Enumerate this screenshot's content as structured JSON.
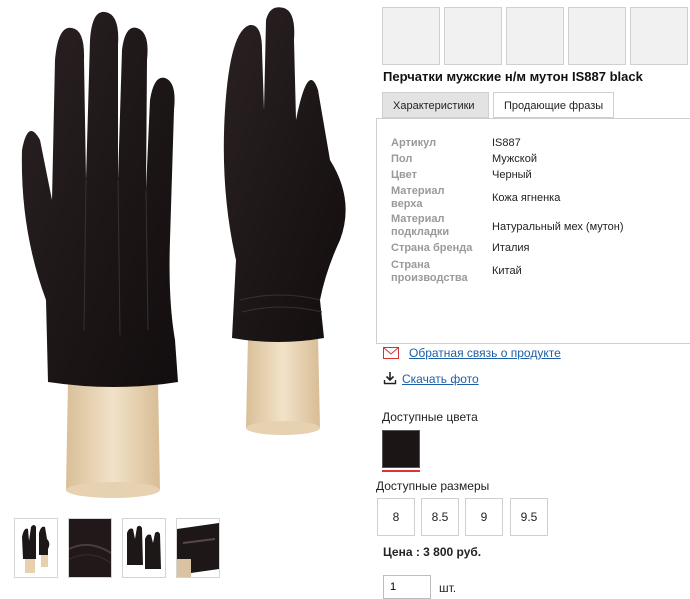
{
  "product": {
    "title": "Перчатки мужские н/м мутон IS887 black"
  },
  "tabs": [
    {
      "label": "Характеристики",
      "active": true
    },
    {
      "label": "Продающие фразы",
      "active": false
    }
  ],
  "specs": [
    {
      "label": "Артикул",
      "value": "IS887"
    },
    {
      "label": "Пол",
      "value": "Мужской"
    },
    {
      "label": "Цвет",
      "value": "Черный"
    },
    {
      "label": "Материал верха",
      "value": "Кожа ягненка"
    },
    {
      "label": "Материал подкладки",
      "value": "Натуральный мех (мутон)"
    },
    {
      "label": "Страна бренда",
      "value": "Италия"
    },
    {
      "label": "Страна производства",
      "value": "Китай"
    }
  ],
  "links": {
    "feedback": "Обратная связь о продукте",
    "download": "Скачать фото"
  },
  "colors": {
    "title": "Доступные цвета",
    "swatch": "#1b1516"
  },
  "sizes": {
    "title": "Доступные размеры",
    "options": [
      "8",
      "8.5",
      "9",
      "9.5"
    ]
  },
  "price": "Цена : 3 800 руб.",
  "quantity": {
    "value": "1",
    "unit": "шт."
  },
  "icons": {
    "feedback": "envelope-icon",
    "download": "download-icon"
  },
  "palette": {
    "link": "#1c5fa8",
    "accent_red": "#d33333",
    "glove": "#1e1718",
    "stand": "#e9d6b8"
  }
}
